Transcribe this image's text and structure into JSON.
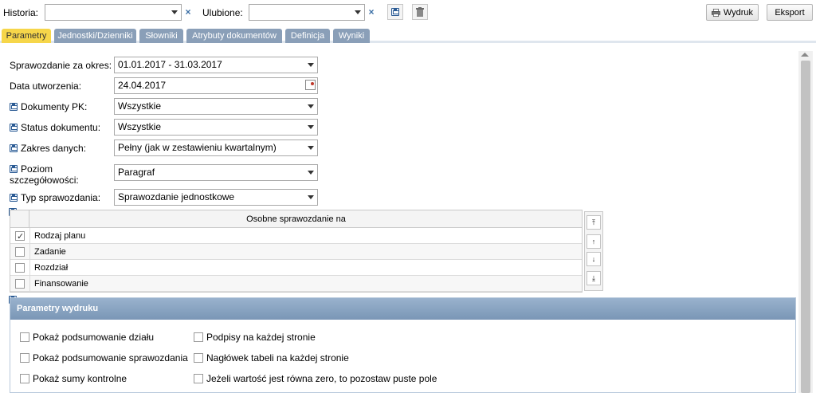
{
  "toolbar": {
    "history_label": "Historia:",
    "history_value": "",
    "favorites_label": "Ulubione:",
    "favorites_value": "",
    "print_label": "Wydruk",
    "export_label": "Eksport",
    "clear_glyph": "×"
  },
  "tabs": [
    {
      "label": "Parametry",
      "active": true
    },
    {
      "label": "Jednostki/Dzienniki",
      "active": false
    },
    {
      "label": "Słowniki",
      "active": false
    },
    {
      "label": "Atrybuty dokumentów",
      "active": false
    },
    {
      "label": "Definicja",
      "active": false
    },
    {
      "label": "Wyniki",
      "active": false
    }
  ],
  "form": {
    "period_label": "Sprawozdanie za okres:",
    "period_value": "01.01.2017 - 31.03.2017",
    "created_label": "Data utworzenia:",
    "created_value": "24.04.2017",
    "pk_docs_label": "Dokumenty PK:",
    "pk_docs_value": "Wszystkie",
    "status_label": "Status dokumentu:",
    "status_value": "Wszystkie",
    "scope_label": "Zakres danych:",
    "scope_value": "Pełny (jak w zestawieniu kwartalnym)",
    "detail_label_1": "Poziom",
    "detail_label_2": "szczegółowości:",
    "detail_value": "Paragraf",
    "type_label": "Typ sprawozdania:",
    "type_value": "Sprawozdanie jednostkowe"
  },
  "grid": {
    "header": "Osobne sprawozdanie na",
    "rows": [
      {
        "label": "Rodzaj planu",
        "checked": true
      },
      {
        "label": "Zadanie",
        "checked": false
      },
      {
        "label": "Rozdział",
        "checked": false
      },
      {
        "label": "Finansowanie",
        "checked": false
      }
    ],
    "move_buttons": [
      "⤒",
      "↑",
      "↓",
      "⤓"
    ]
  },
  "print_params": {
    "title": "Parametry wydruku",
    "options_left": [
      {
        "label": "Pokaż podsumowanie działu",
        "checked": false
      },
      {
        "label": "Pokaż podsumowanie sprawozdania",
        "checked": false
      },
      {
        "label": "Pokaż sumy kontrolne",
        "checked": false
      }
    ],
    "options_right": [
      {
        "label": "Podpisy na każdej stronie",
        "checked": false
      },
      {
        "label": "Nagłówek tabeli na każdej stronie",
        "checked": false
      },
      {
        "label": "Jeżeli wartość jest równa zero, to pozostaw puste pole",
        "checked": false
      }
    ]
  },
  "colors": {
    "active_tab": "#f6d64a",
    "inactive_tab": "#8a9fb8",
    "panel_header": "#7a96b6",
    "link_blue": "#2a5a93"
  }
}
